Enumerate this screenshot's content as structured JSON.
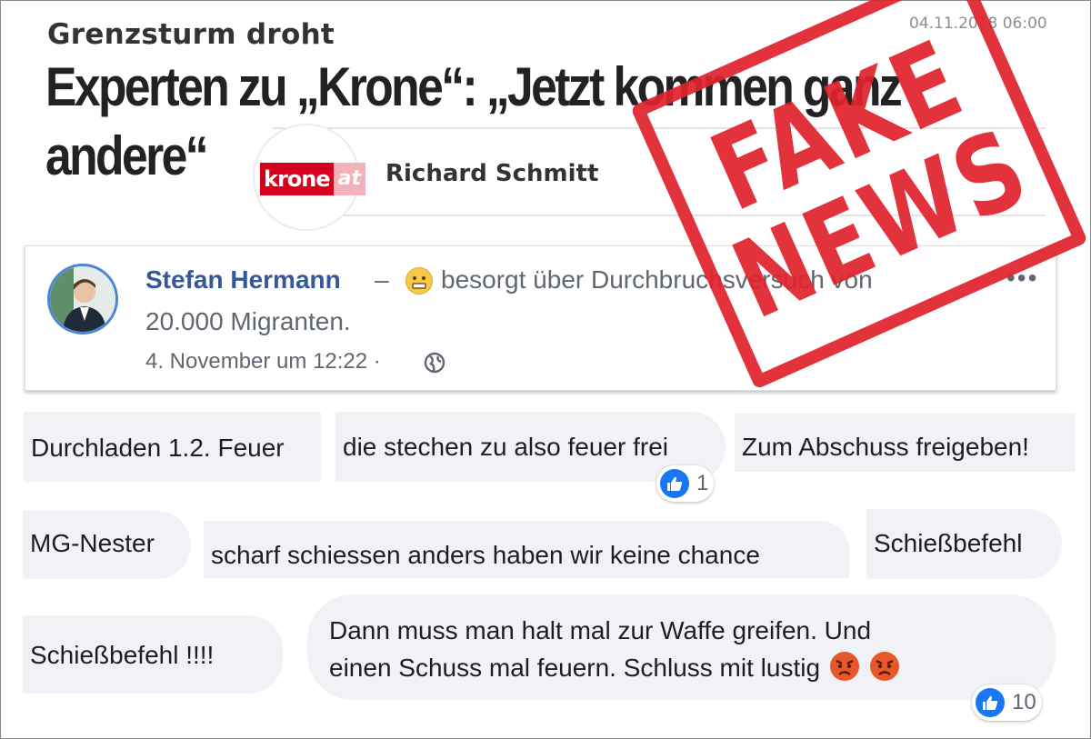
{
  "article": {
    "kicker": "Grenzsturm droht",
    "date": "04.11.2018 06:00",
    "headline": "Experten zu „Krone“: „Jetzt kommen ganz andere“",
    "logo_krone": "krone",
    "logo_at": "at",
    "author": "Richard Schmitt"
  },
  "post": {
    "author": "Stefan Hermann",
    "separator": "–",
    "status_line1": "besorgt über Durchbruchsversuch von",
    "status_line2": "20.000 Migranten.",
    "timestamp": "4. November um 12:22 ·",
    "more": "•••",
    "emoji_icon": "worried-face-icon"
  },
  "comments": [
    {
      "text": "Durchladen 1.2. Feuer"
    },
    {
      "text": "die stechen zu also feuer frei",
      "likes": "1"
    },
    {
      "text": "Zum Abschuss freigeben!"
    },
    {
      "text": "MG-Nester"
    },
    {
      "text": "scharf schiessen anders haben wir keine chance"
    },
    {
      "text": "Schießbefehl"
    },
    {
      "text": "Schießbefehl !!!!"
    },
    {
      "text_line1": "Dann muss man halt mal zur Waffe greifen. Und",
      "text_line2": "einen Schuss mal feuern. Schluss mit lustig",
      "likes": "10"
    }
  ],
  "stamp": {
    "line1": "FAKE",
    "line2": "NEWS",
    "color": "#e0242e"
  },
  "colors": {
    "facebook_name": "#365899",
    "facebook_like": "#1877f2",
    "bubble_bg": "#f0f2f5",
    "krone_red": "#d6001c"
  }
}
